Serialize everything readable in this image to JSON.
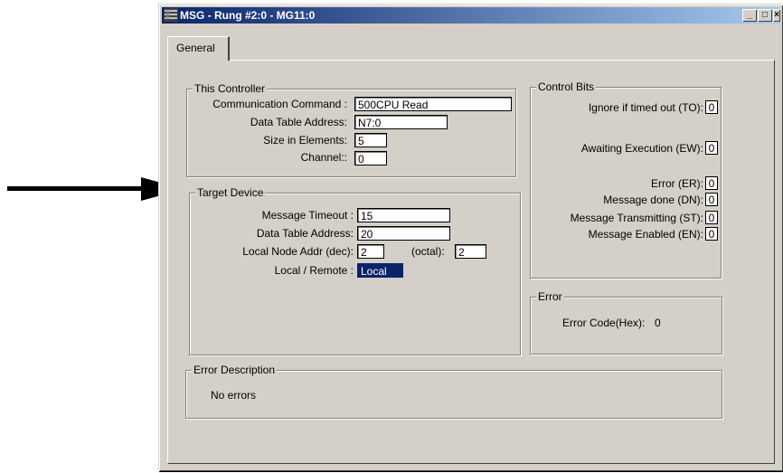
{
  "window": {
    "title": "MSG - Rung #2:0 - MG11:0",
    "minimize_label": "_",
    "maximize_label": "□",
    "close_label": "×"
  },
  "tabs": [
    {
      "label": "General",
      "active": true
    }
  ],
  "this_controller": {
    "title": "This Controller",
    "communication_command_label": "Communication Command :",
    "communication_command_value": "500CPU Read",
    "data_table_address_label": "Data Table Address:",
    "data_table_address_value": "N7:0",
    "size_in_elements_label": "Size in Elements:",
    "size_in_elements_value": "5",
    "channel_label": "Channel::",
    "channel_value": "0"
  },
  "target_device": {
    "title": "Target Device",
    "message_timeout_label": "Message Timeout :",
    "message_timeout_value": "15",
    "data_table_address_label": "Data Table Address:",
    "data_table_address_value": "20",
    "local_node_addr_label": "Local Node Addr (dec):",
    "local_node_addr_value": "2",
    "octal_label": "(octal):",
    "octal_value": "2",
    "local_remote_label": "Local / Remote :",
    "local_remote_value": "Local"
  },
  "control_bits": {
    "title": "Control Bits",
    "items": [
      {
        "label": "Ignore if timed out (TO):",
        "value": "0"
      },
      {
        "label": "Awaiting Execution (EW):",
        "value": "0"
      },
      {
        "label": "Error (ER):",
        "value": "0"
      },
      {
        "label": "Message done (DN):",
        "value": "0"
      },
      {
        "label": "Message Transmitting (ST):",
        "value": "0"
      },
      {
        "label": "Message Enabled (EN):",
        "value": "0"
      }
    ]
  },
  "error": {
    "title": "Error",
    "code_label": "Error Code(Hex):",
    "code_value": "0"
  },
  "error_description": {
    "title": "Error Description",
    "text": "No errors"
  },
  "colors": {
    "dialog_face": "#d4d0c8",
    "titlebar_start": "#0a246a",
    "titlebar_end": "#a6caf0",
    "selection": "#0a246a"
  }
}
